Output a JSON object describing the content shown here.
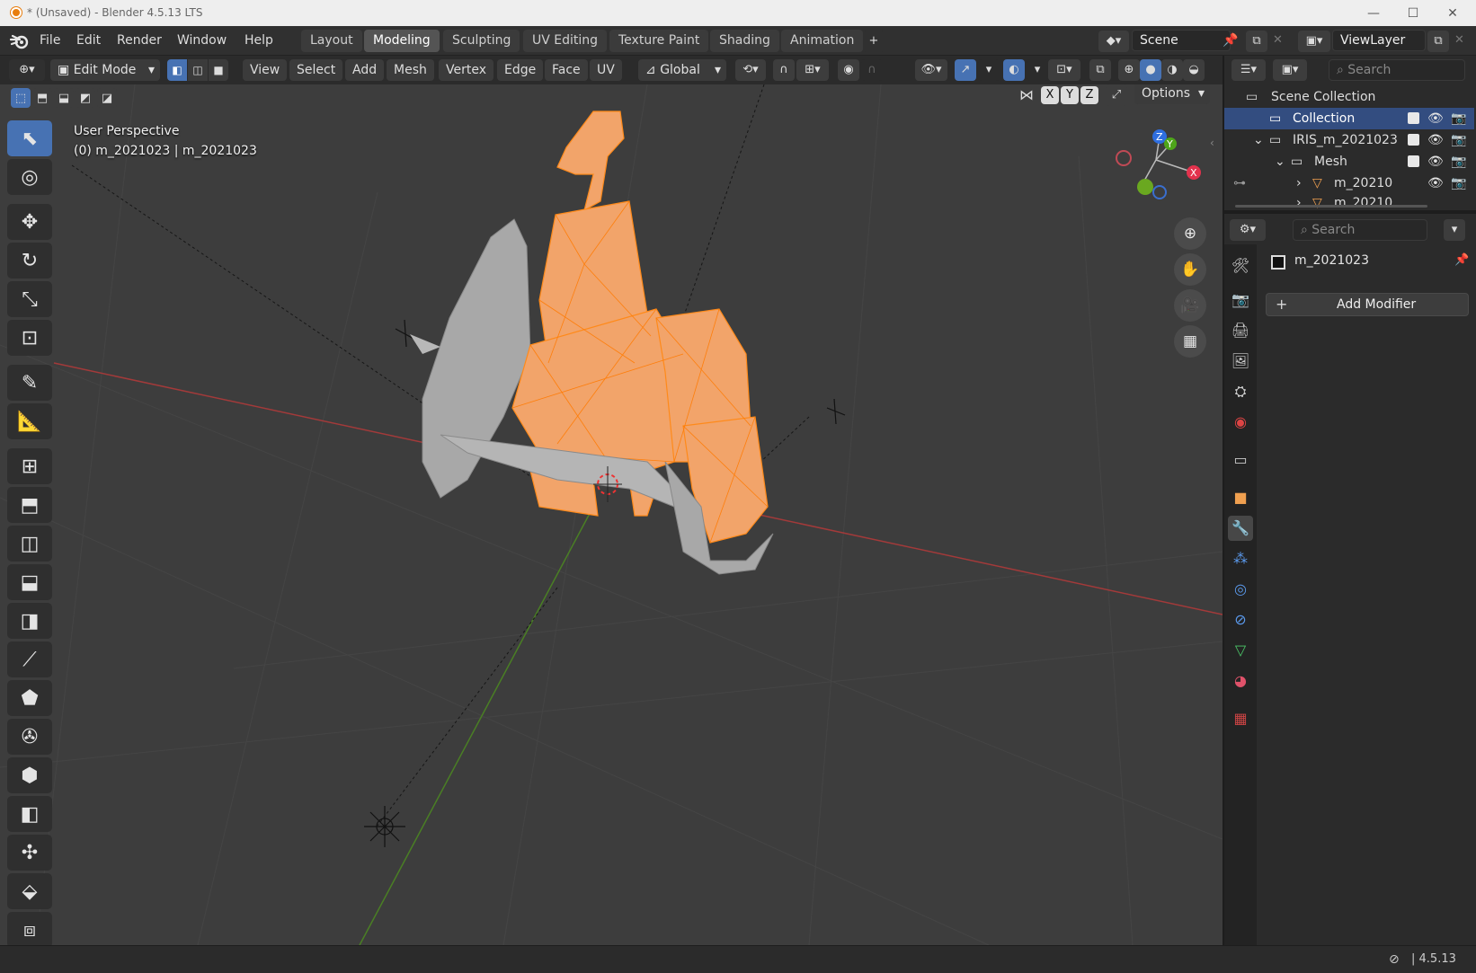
{
  "window": {
    "title": "* (Unsaved) - Blender 4.5.13 LTS",
    "minimize_glyph": "—",
    "maximize_glyph": "☐",
    "close_glyph": "✕"
  },
  "menu": {
    "items": [
      "File",
      "Edit",
      "Render",
      "Window",
      "Help"
    ]
  },
  "workspaces": {
    "tabs": [
      "Layout",
      "Modeling",
      "Sculpting",
      "UV Editing",
      "Texture Paint",
      "Shading",
      "Animation"
    ],
    "active": "Modeling",
    "add_glyph": "+"
  },
  "scene": {
    "name": "Scene"
  },
  "view_layer": {
    "name": "ViewLayer"
  },
  "header": {
    "mode": "Edit Mode",
    "menus": [
      "View",
      "Select",
      "Add",
      "Mesh",
      "Vertex",
      "Edge",
      "Face",
      "UV"
    ],
    "transform_orientation": "Global",
    "mirror_axes": [
      "X",
      "Y",
      "Z"
    ],
    "options_label": "Options"
  },
  "viewport": {
    "perspective_label": "User Perspective",
    "object_label": "(0) m_2021023 | m_2021023",
    "gizmo": {
      "z": "Z",
      "y": "Y",
      "x": "X"
    },
    "colors": {
      "selection": "#f08a24",
      "mesh": "#9a9a9a",
      "x_axis": "#b83a3a",
      "y_axis": "#5a8a2a",
      "background": "#3d3d3d"
    }
  },
  "outliner": {
    "search_placeholder": "Search",
    "rows": [
      {
        "label": "Scene Collection",
        "indent": 0
      },
      {
        "label": "Collection",
        "indent": 1,
        "selected": true
      },
      {
        "label": "IRIS_m_2021023",
        "indent": 1
      },
      {
        "label": "Mesh",
        "indent": 2
      },
      {
        "label": "m_20210",
        "indent": 3
      },
      {
        "label": "m_20210",
        "indent": 3
      }
    ]
  },
  "properties": {
    "search_placeholder": "Search",
    "object_name": "m_2021023",
    "add_modifier_label": "Add Modifier",
    "active_tab": "modifiers"
  },
  "status": {
    "version": "4.5.13"
  }
}
